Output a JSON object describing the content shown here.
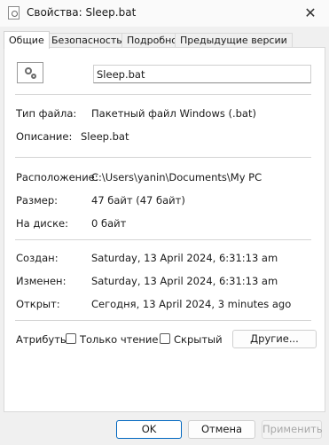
{
  "window": {
    "title": "Свойства: Sleep.bat"
  },
  "tabs": [
    {
      "label": "Общие"
    },
    {
      "label": "Безопасность"
    },
    {
      "label": "Подробно"
    },
    {
      "label": "Предыдущие версии"
    }
  ],
  "file": {
    "name": "Sleep.bat",
    "icon": "batch-file-gear-icon"
  },
  "info": {
    "type_label": "Тип файла:",
    "type_value": "Пакетный файл Windows (.bat)",
    "desc_label": "Описание:",
    "desc_value": "Sleep.bat",
    "location_label": "Расположение:",
    "location_value": "C:\\Users\\yanin\\Documents\\My PC",
    "size_label": "Размер:",
    "size_value": "47 байт (47 байт)",
    "disk_label": "На диске:",
    "disk_value": "0 байт",
    "created_label": "Создан:",
    "created_value": "Saturday, 13 April 2024, 6:31:13 am",
    "modified_label": "Изменен:",
    "modified_value": "Saturday, 13 April 2024, 6:31:13 am",
    "opened_label": "Открыт:",
    "opened_value": "Сегодня, 13 April 2024, 3 minutes ago"
  },
  "attributes": {
    "label": "Атрибуты:",
    "readonly_label": "Только чтение",
    "hidden_label": "Скрытый",
    "other_button": "Другие..."
  },
  "footer": {
    "ok": "OK",
    "cancel": "Отмена",
    "apply": "Применить"
  },
  "colors": {
    "accent": "#0067c0",
    "background": "#f0f0f0",
    "panel": "#ffffff"
  }
}
